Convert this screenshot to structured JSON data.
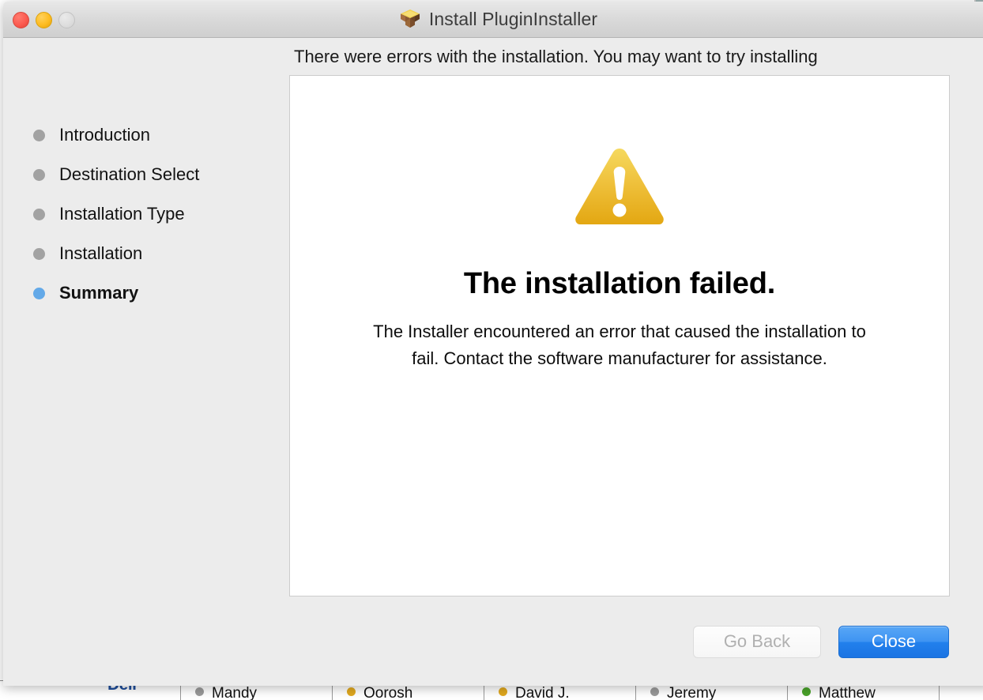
{
  "window": {
    "title": "Install PluginInstaller",
    "icon": "package-box-icon",
    "traffic_lights": {
      "close_label": "close",
      "minimize_label": "minimize",
      "zoom_label": "zoom",
      "close_color": "#fb5b50",
      "minimize_color": "#fdbc22",
      "zoom_color": "#dedede"
    }
  },
  "banner": {
    "text": "There were errors with the installation. You may want to try installing"
  },
  "sidebar": {
    "items": [
      {
        "label": "Introduction",
        "state": "done"
      },
      {
        "label": "Destination Select",
        "state": "done"
      },
      {
        "label": "Installation Type",
        "state": "done"
      },
      {
        "label": "Installation",
        "state": "done"
      },
      {
        "label": "Summary",
        "state": "active"
      }
    ],
    "dot_color_inactive": "#a2a2a2",
    "dot_color_active": "#63a9e8"
  },
  "content": {
    "icon": "warning-triangle-icon",
    "icon_color": "#eab02a",
    "heading": "The installation failed.",
    "body": "The Installer encountered an error that caused the installation to fail. Contact the software manufacturer for assistance."
  },
  "buttons": {
    "go_back": {
      "label": "Go Back",
      "enabled": false
    },
    "close": {
      "label": "Close",
      "enabled": true,
      "accent_color": "#2280ec"
    }
  },
  "background": {
    "contacts_strip": {
      "logo_text": "Dell",
      "people": [
        {
          "name": "Mandy",
          "status_color": "#9a9a9a"
        },
        {
          "name": "Oorosh",
          "status_color": "#e0a81f"
        },
        {
          "name": "David J.",
          "status_color": "#e0a81f"
        },
        {
          "name": "Jeremy",
          "status_color": "#9a9a9a"
        },
        {
          "name": "Matthew",
          "status_color": "#4aa32a"
        }
      ]
    }
  }
}
